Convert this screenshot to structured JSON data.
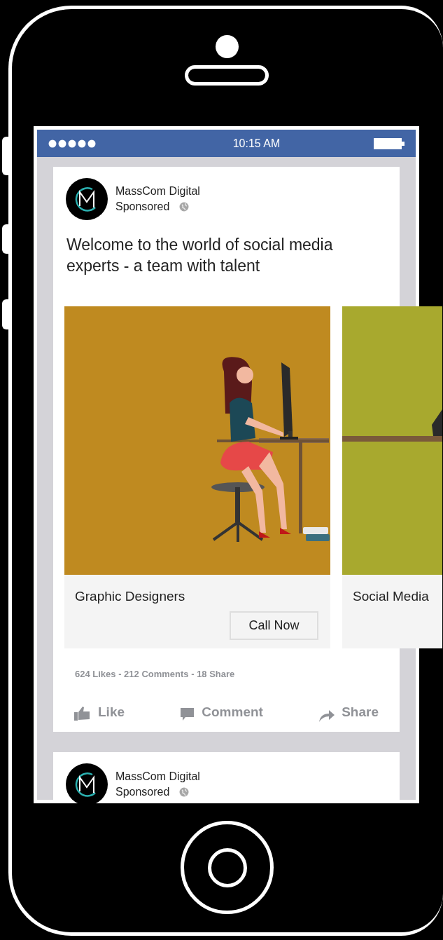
{
  "status_bar": {
    "time": "10:15 AM"
  },
  "posts": [
    {
      "page_name": "MassCom Digital",
      "label": "Sponsored",
      "message": "Welcome to the world of social media experts - a team with talent",
      "carousel": [
        {
          "title": "Graphic Designers",
          "button": "Call Now"
        },
        {
          "title": "Social Media"
        }
      ],
      "stats": "624 Likes - 212 Comments - 18 Share",
      "actions": [
        {
          "kind": "like",
          "label": "Like"
        },
        {
          "kind": "comment",
          "label": "Comment"
        },
        {
          "kind": "share",
          "label": "Share"
        }
      ]
    },
    {
      "page_name": "MassCom Digital",
      "label": "Sponsored"
    }
  ]
}
